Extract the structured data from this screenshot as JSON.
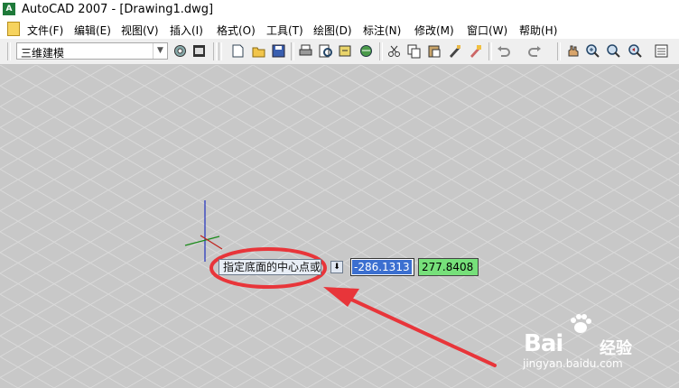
{
  "window": {
    "app_icon": "autocad-icon",
    "title": "AutoCAD 2007 - [Drawing1.dwg]"
  },
  "menu": [
    {
      "label": "文件(F)"
    },
    {
      "label": "编辑(E)"
    },
    {
      "label": "视图(V)"
    },
    {
      "label": "插入(I)"
    },
    {
      "label": "格式(O)"
    },
    {
      "label": "工具(T)"
    },
    {
      "label": "绘图(D)"
    },
    {
      "label": "标注(N)"
    },
    {
      "label": "修改(M)"
    },
    {
      "label": "窗口(W)"
    },
    {
      "label": "帮助(H)"
    }
  ],
  "toolbar": {
    "workspace": "三维建模",
    "icons": [
      "workspace-settings-icon",
      "my-workspace-icon",
      "new-icon",
      "open-icon",
      "save-icon",
      "print-icon",
      "plot-preview-icon",
      "publish-icon",
      "3d-dwf-icon",
      "cut-icon",
      "copy-icon",
      "paste-icon",
      "match-properties-icon",
      "block-editor-icon",
      "undo-icon",
      "redo-icon",
      "pan-icon",
      "zoom-realtime-icon",
      "zoom-window-icon",
      "zoom-previous-icon",
      "properties-icon"
    ]
  },
  "dynamic_input": {
    "prompt": "指定底面的中心点或",
    "x_value": "-286.1313",
    "y_value": "277.8408"
  },
  "watermark": {
    "brand": "Bai",
    "brand_suffix": "经验",
    "url": "jingyan.baidu.com"
  },
  "colors": {
    "canvas": "#c8c8c8",
    "annotation": "#e8353a",
    "field_active": "#3b6fd0",
    "field_green": "#76e07a"
  }
}
